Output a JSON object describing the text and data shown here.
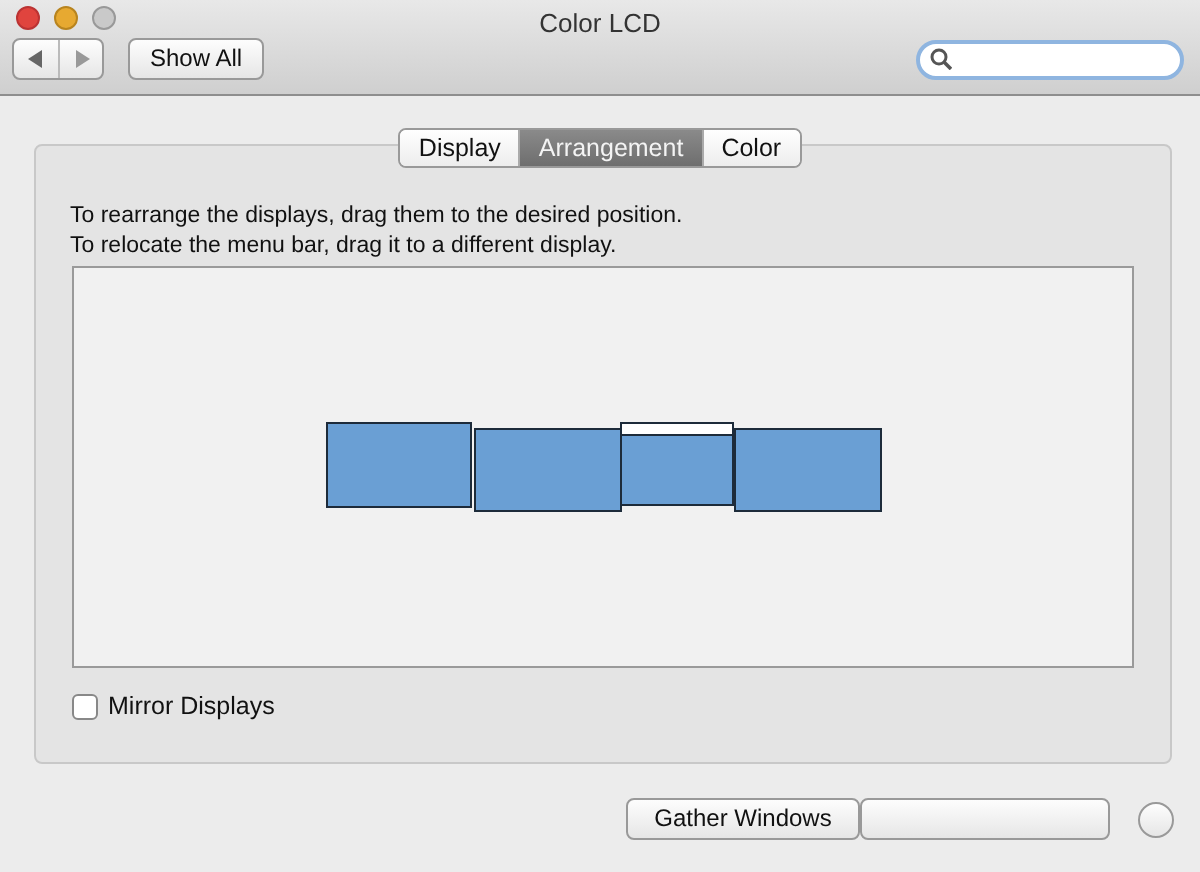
{
  "window": {
    "title": "Color LCD"
  },
  "toolbar": {
    "show_all": "Show All"
  },
  "tabs": [
    {
      "label": "Display",
      "selected": false
    },
    {
      "label": "Arrangement",
      "selected": true
    },
    {
      "label": "Color",
      "selected": false
    }
  ],
  "instructions": [
    "To rearrange the displays, drag them to the desired position.",
    "To relocate the menu bar, drag it to a different display."
  ],
  "displays": [
    {
      "menu_bar": false
    },
    {
      "menu_bar": false
    },
    {
      "menu_bar": true
    },
    {
      "menu_bar": false
    }
  ],
  "mirror_displays": {
    "label": "Mirror Displays",
    "checked": false
  },
  "buttons": [
    {
      "label": "Gather Windows"
    }
  ]
}
